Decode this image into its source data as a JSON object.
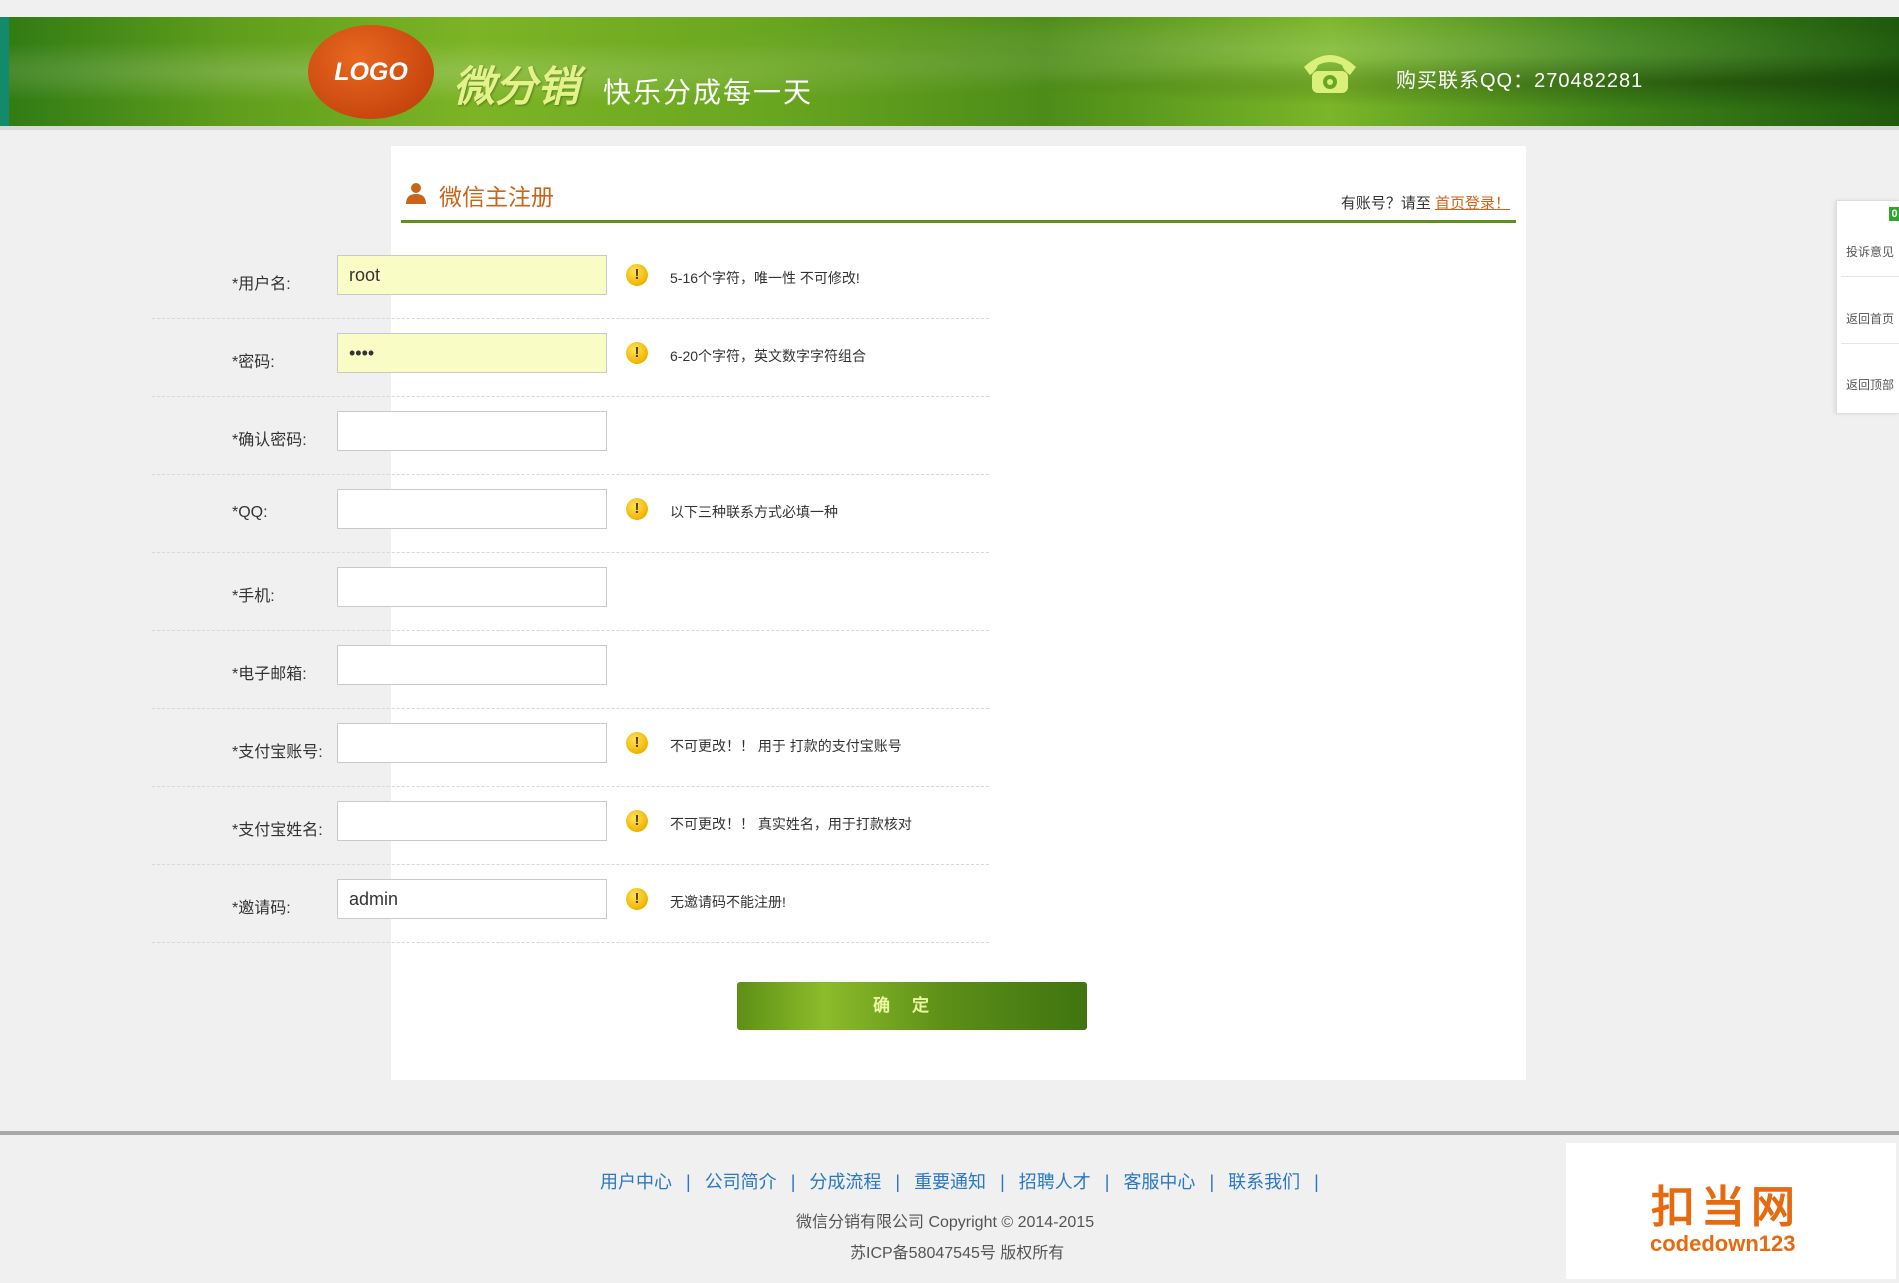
{
  "header": {
    "logo_text": "LOGO",
    "brand": "微分销",
    "slogan": "快乐分成每一天",
    "contact": "购买联系QQ：270482281"
  },
  "panel": {
    "title": "微信主注册",
    "login_hint_prefix": "有账号？请至 ",
    "login_link": "首页登录！"
  },
  "form": {
    "fields": [
      {
        "label": "*用户名:",
        "value": "root",
        "tip": "5-16个字符，唯一性 不可修改!"
      },
      {
        "label": "*密码:",
        "value": "••••",
        "tip": "6-20个字符，英文数字字符组合"
      },
      {
        "label": "*确认密码:",
        "value": "",
        "tip": ""
      },
      {
        "label": "*QQ:",
        "value": "",
        "tip": "以下三种联系方式必填一种"
      },
      {
        "label": "*手机:",
        "value": "",
        "tip": ""
      },
      {
        "label": "*电子邮箱:",
        "value": "",
        "tip": ""
      },
      {
        "label": "*支付宝账号:",
        "value": "",
        "tip": "不可更改！！  用于 打款的支付宝账号"
      },
      {
        "label": "*支付宝姓名:",
        "value": "",
        "tip": "不可更改！！  真实姓名，用于打款核对"
      },
      {
        "label": "*邀请码:",
        "value": "admin",
        "tip": "无邀请码不能注册!"
      }
    ],
    "warn_glyph": "!",
    "submit_label": "确定"
  },
  "footer": {
    "links": [
      "用户中心",
      "公司简介",
      "分成流程",
      "重要通知",
      "招聘人才",
      "客服中心",
      "联系我们"
    ],
    "separator": "|",
    "copyright": "微信分销有限公司   Copyright © 2014-2015",
    "icp": "苏ICP备58047545号 版权所有"
  },
  "watermark": {
    "title": "扣当网",
    "subtitle": "codedown123"
  },
  "sidebar": {
    "badge": "0",
    "items": [
      "投诉意见",
      "返回首页",
      "返回顶部"
    ]
  },
  "colors": {
    "accent_green": "#5f8f1e",
    "title_orange": "#c8651a",
    "link_blue": "#2a78c5",
    "input_filled_bg": "#fafcc6"
  }
}
